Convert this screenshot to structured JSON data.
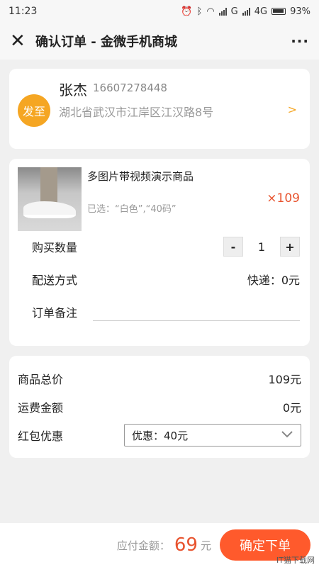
{
  "status": {
    "time": "11:23",
    "network": "G",
    "network2": "4G",
    "battery": "93%"
  },
  "header": {
    "title": "确认订单 - 金微手机商城"
  },
  "address": {
    "badge": "发至",
    "name": "张杰",
    "phone": "16607278448",
    "line": "湖北省武汉市江岸区江汉路8号",
    "chevron": ">"
  },
  "goods": {
    "name": "多图片带视频演示商品",
    "options": "已选：“白色”,“40码”",
    "qty": "×109"
  },
  "quantity": {
    "label": "购买数量",
    "minus": "-",
    "value": "1",
    "plus": "+"
  },
  "delivery": {
    "label": "配送方式",
    "value": "快递：0元"
  },
  "note": {
    "label": "订单备注",
    "placeholder": ""
  },
  "summary": {
    "total_label": "商品总价",
    "total_value": "109元",
    "shipping_label": "运费金额",
    "shipping_value": "0元",
    "coupon_label": "红包优惠",
    "coupon_value": "优惠：40元"
  },
  "footer": {
    "pay_label": "应付金额：",
    "pay_value": "69",
    "pay_unit": "元",
    "submit_label": "确定下单"
  },
  "watermark": "IT猫下载网",
  "colors": {
    "accent": "#ff5a2c",
    "badge": "#f5a623",
    "price": "#e8532e"
  }
}
